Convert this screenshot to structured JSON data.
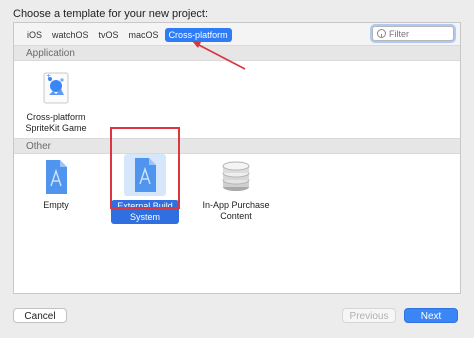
{
  "window": {
    "title": "Choose a template for your new project:"
  },
  "platform_tabs": [
    {
      "label": "iOS",
      "selected": false
    },
    {
      "label": "watchOS",
      "selected": false
    },
    {
      "label": "tvOS",
      "selected": false
    },
    {
      "label": "macOS",
      "selected": false
    },
    {
      "label": "Cross-platform",
      "selected": true
    }
  ],
  "filter": {
    "placeholder": "Filter",
    "value": ""
  },
  "sections": {
    "application": {
      "header": "Application",
      "templates": [
        {
          "label": "Cross-platform SpriteKit Game",
          "icon": "spritekit-game-icon"
        }
      ]
    },
    "other": {
      "header": "Other",
      "templates": [
        {
          "label": "Empty",
          "icon": "xcode-project-blueprint-icon",
          "selected": false
        },
        {
          "label": "External Build System",
          "icon": "xcode-project-blueprint-icon",
          "selected": true
        },
        {
          "label": "In-App Purchase Content",
          "icon": "coin-stack-icon",
          "selected": false
        }
      ]
    }
  },
  "buttons": {
    "cancel": "Cancel",
    "previous": "Previous",
    "next": "Next"
  },
  "colors": {
    "accent": "#2f7df6",
    "annotation_red": "#d9363e"
  }
}
